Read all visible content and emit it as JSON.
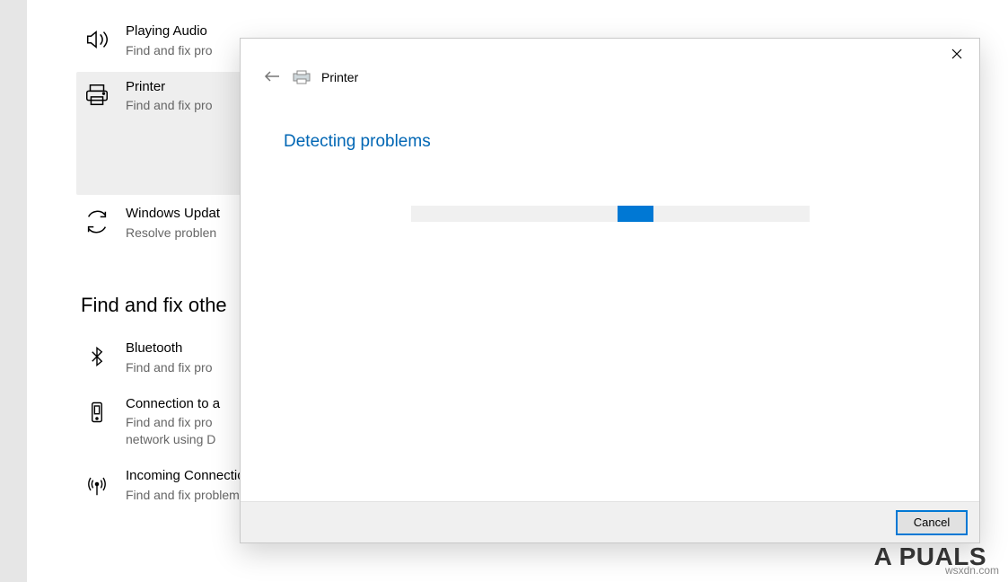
{
  "settings": {
    "items": [
      {
        "title": "Playing Audio",
        "desc": "Find and fix pro"
      },
      {
        "title": "Printer",
        "desc": "Find and fix pro"
      },
      {
        "title": "Windows Updat",
        "desc": "Resolve problen"
      }
    ],
    "section_heading": "Find and fix othe",
    "other_items": [
      {
        "title": "Bluetooth",
        "desc": "Find and fix pro"
      },
      {
        "title": "Connection to a",
        "desc": "Find and fix pro\nnetwork using D"
      },
      {
        "title": "Incoming Connections",
        "desc": "Find and fix problems with incoming computer connections and"
      }
    ]
  },
  "dialog": {
    "title": "Printer",
    "heading": "Detecting problems",
    "cancel_label": "Cancel"
  },
  "watermark": "wsxdn.com",
  "logo": "A  PUALS"
}
